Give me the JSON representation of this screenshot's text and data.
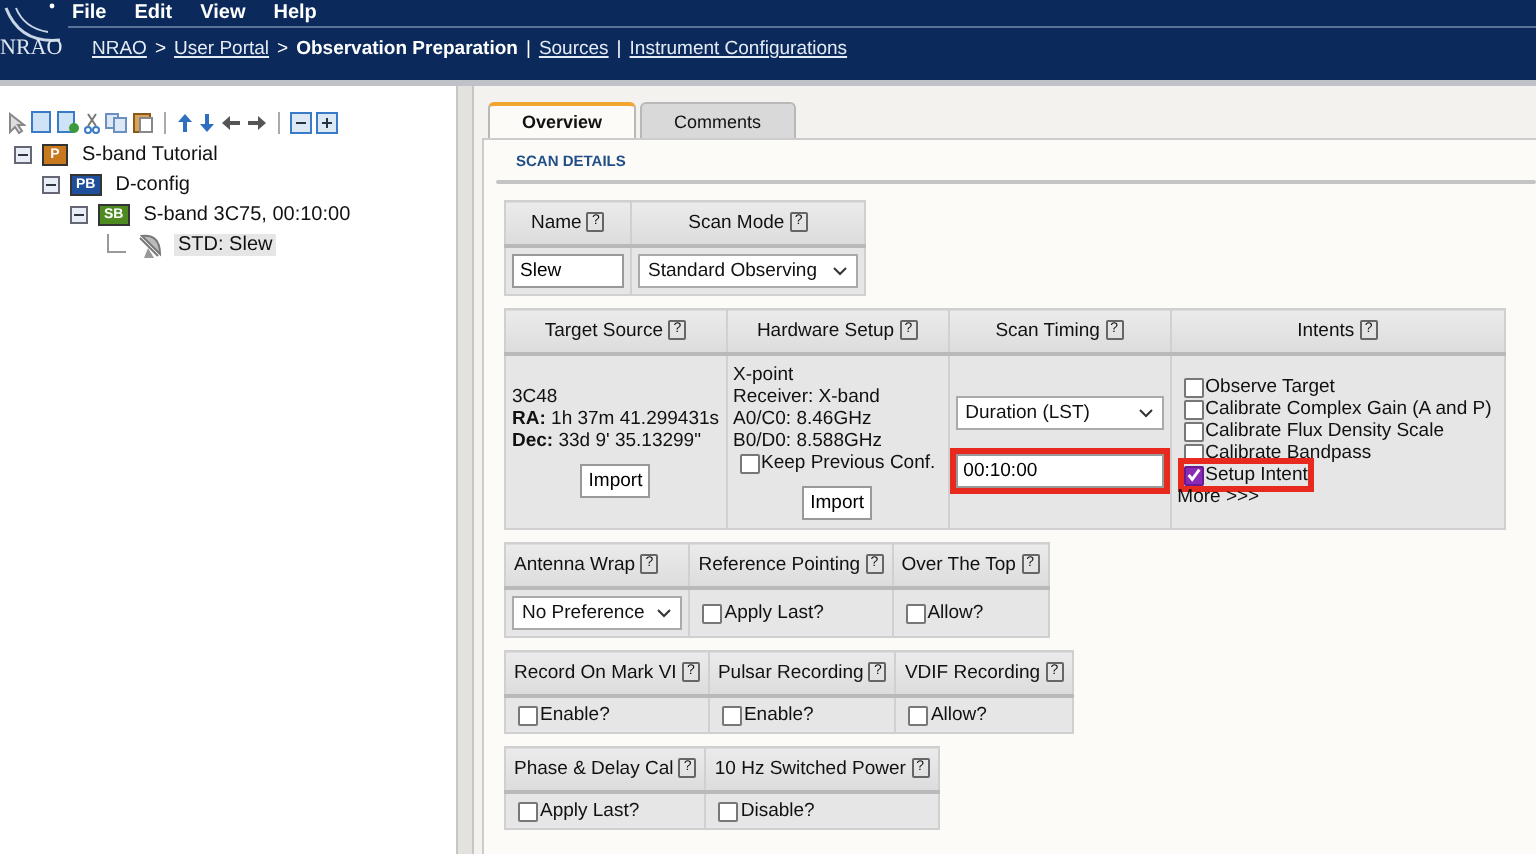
{
  "header": {
    "logo_text": "NRAO",
    "menu": [
      "File",
      "Edit",
      "View",
      "Help"
    ],
    "breadcrumb": [
      {
        "label": "NRAO",
        "kind": "link"
      },
      {
        "label": ">",
        "kind": "sep"
      },
      {
        "label": "User Portal",
        "kind": "link"
      },
      {
        "label": ">",
        "kind": "sep"
      },
      {
        "label": "Observation Preparation",
        "kind": "current"
      },
      {
        "label": "|",
        "kind": "sep"
      },
      {
        "label": "Sources",
        "kind": "link"
      },
      {
        "label": "|",
        "kind": "sep"
      },
      {
        "label": "Instrument Configurations",
        "kind": "link"
      }
    ]
  },
  "tree": [
    {
      "label": "S-band Tutorial",
      "badge": "P",
      "color": "#c8791e",
      "expanded": true,
      "selected": false,
      "children": [
        {
          "label": "D-config",
          "badge": "PB",
          "color": "#1f4f9a",
          "expanded": true,
          "selected": false,
          "children": [
            {
              "label": "S-band 3C75, 00:10:00",
              "badge": "SB",
              "color": "#4d8a1f",
              "expanded": true,
              "selected": false,
              "children": [
                {
                  "label": "STD: Slew",
                  "kind": "scan",
                  "selected": true
                }
              ]
            }
          ]
        }
      ]
    }
  ],
  "tabs": [
    {
      "label": "Overview",
      "selected": true
    },
    {
      "label": "Comments",
      "selected": false
    }
  ],
  "section_title": "SCAN DETAILS",
  "tables": [
    {
      "columns": [
        "Name",
        "Scan Mode"
      ],
      "cells": [
        [
          {
            "kind": "field",
            "value": "Slew"
          }
        ],
        [
          {
            "kind": "select",
            "value": "Standard Observing"
          }
        ]
      ]
    },
    {
      "columns": [
        "Target Source",
        "Hardware Setup",
        "Scan Timing",
        "Intents"
      ],
      "cells": [
        [
          {
            "kind": "text",
            "text": "3C48"
          },
          {
            "kind": "text",
            "text": "**RA:** 1h 37m 41.299431s"
          },
          {
            "kind": "text",
            "text": "**Dec:** 33d 9' 35.13299\""
          },
          {
            "kind": "button",
            "label": "Import"
          }
        ],
        [
          {
            "kind": "text",
            "text": "X-point"
          },
          {
            "kind": "text",
            "text": "Receiver: X-band"
          },
          {
            "kind": "text",
            "text": "A0/C0: 8.46GHz"
          },
          {
            "kind": "text",
            "text": "B0/D0: 8.588GHz"
          },
          {
            "kind": "checkbox",
            "label": "Keep Previous Conf.",
            "checked": false,
            "highlighted": false
          },
          {
            "kind": "button",
            "label": "Import"
          }
        ],
        [
          {
            "kind": "select",
            "value": "Duration (LST)"
          },
          {
            "kind": "field",
            "value": "00:10:00",
            "highlighted": true
          }
        ],
        [
          {
            "kind": "checkbox",
            "label": "Observe Target",
            "checked": false,
            "highlighted": false
          },
          {
            "kind": "checkbox",
            "label": "Calibrate Complex Gain (A and P)",
            "checked": false,
            "highlighted": false
          },
          {
            "kind": "checkbox",
            "label": "Calibrate Flux Density Scale",
            "checked": false,
            "highlighted": false
          },
          {
            "kind": "checkbox",
            "label": "Calibrate Bandpass",
            "checked": false,
            "highlighted": false
          },
          {
            "kind": "checkbox",
            "label": "Setup Intent",
            "checked": true,
            "highlighted": true
          },
          {
            "kind": "link",
            "label": "More >>>"
          }
        ]
      ]
    },
    {
      "columns": [
        "Antenna Wrap",
        "Reference Pointing",
        "Over The Top"
      ],
      "cells": [
        [
          {
            "kind": "select",
            "value": "No Preference"
          }
        ],
        [
          {
            "kind": "checkbox",
            "label": "Apply Last?",
            "checked": false,
            "highlighted": false
          }
        ],
        [
          {
            "kind": "checkbox",
            "label": "Allow?",
            "checked": false,
            "highlighted": false
          }
        ]
      ]
    },
    {
      "columns": [
        "Record On Mark VI",
        "Pulsar Recording",
        "VDIF Recording"
      ],
      "cells": [
        [
          {
            "kind": "checkbox",
            "label": "Enable?",
            "checked": false,
            "highlighted": false
          }
        ],
        [
          {
            "kind": "checkbox",
            "label": "Enable?",
            "checked": false,
            "highlighted": false
          }
        ],
        [
          {
            "kind": "checkbox",
            "label": "Allow?",
            "checked": false,
            "highlighted": false
          }
        ]
      ]
    },
    {
      "columns": [
        "Phase & Delay Cal",
        "10 Hz Switched Power"
      ],
      "cells": [
        [
          {
            "kind": "checkbox",
            "label": "Apply Last?",
            "checked": false,
            "highlighted": false
          }
        ],
        [
          {
            "kind": "checkbox",
            "label": "Disable?",
            "checked": false,
            "highlighted": false
          }
        ]
      ]
    }
  ],
  "help_mark": "?"
}
